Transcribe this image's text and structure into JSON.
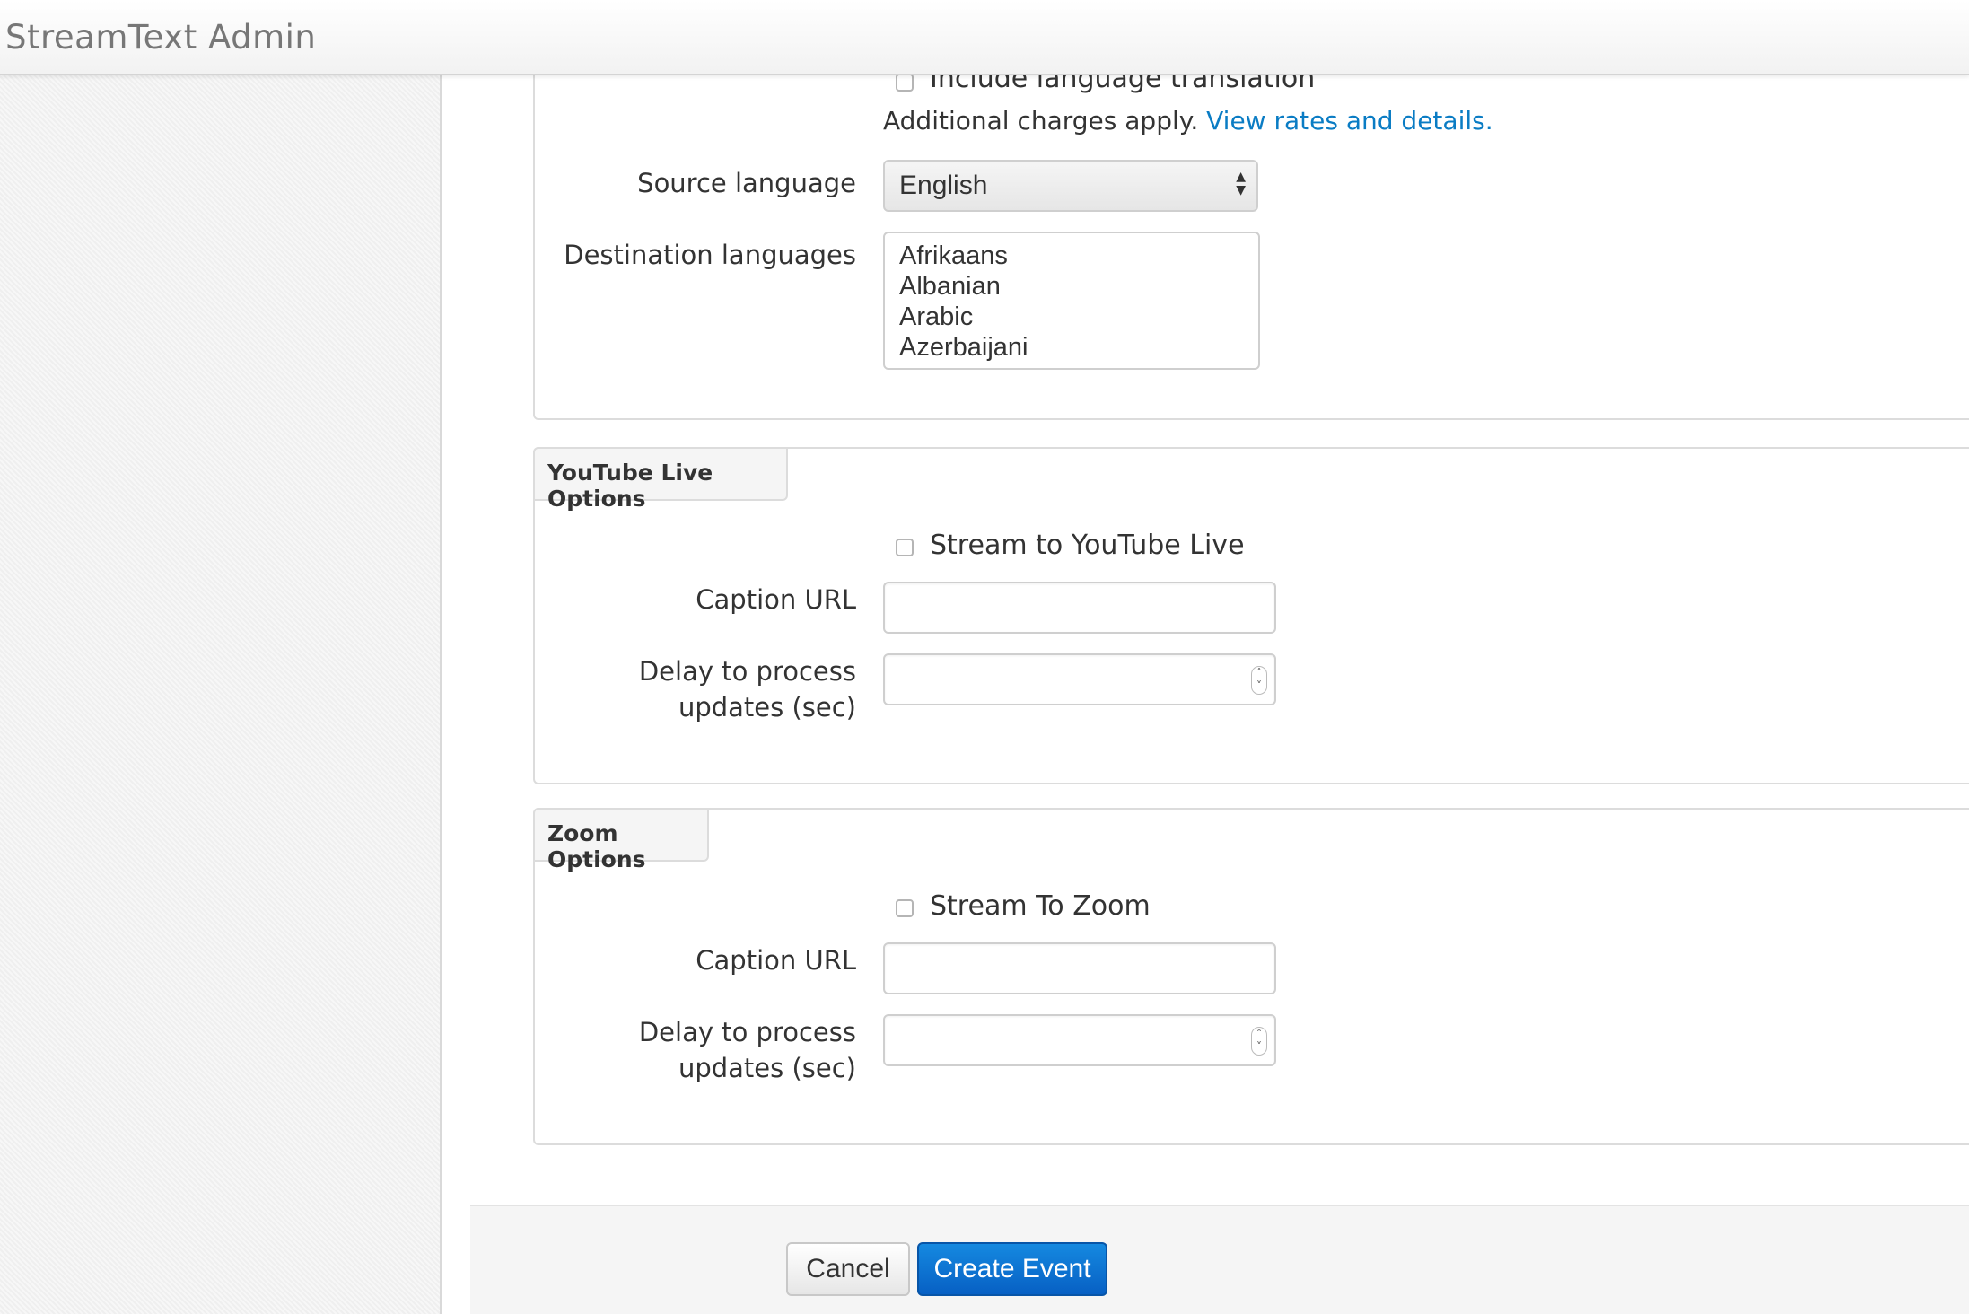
{
  "app": {
    "title": "StreamText Admin"
  },
  "translation": {
    "checkbox_label": "Include language translation",
    "help_text": "Additional charges apply.",
    "help_link": "View rates and details.",
    "source_language_label": "Source language",
    "source_language_value": "English",
    "destination_languages_label": "Destination languages",
    "destination_options": [
      "Afrikaans",
      "Albanian",
      "Arabic",
      "Azerbaijani"
    ]
  },
  "youtube": {
    "legend": "YouTube Live Options",
    "checkbox_label": "Stream to YouTube Live",
    "caption_url_label": "Caption URL",
    "caption_url_value": "",
    "delay_label_line1": "Delay to process",
    "delay_label_line2": "updates (sec)",
    "delay_value": ""
  },
  "zoom": {
    "legend": "Zoom Options",
    "checkbox_label": "Stream To Zoom",
    "caption_url_label": "Caption URL",
    "caption_url_value": "",
    "delay_label_line1": "Delay to process",
    "delay_label_line2": "updates (sec)",
    "delay_value": ""
  },
  "actions": {
    "cancel_label": "Cancel",
    "create_label": "Create Event"
  }
}
